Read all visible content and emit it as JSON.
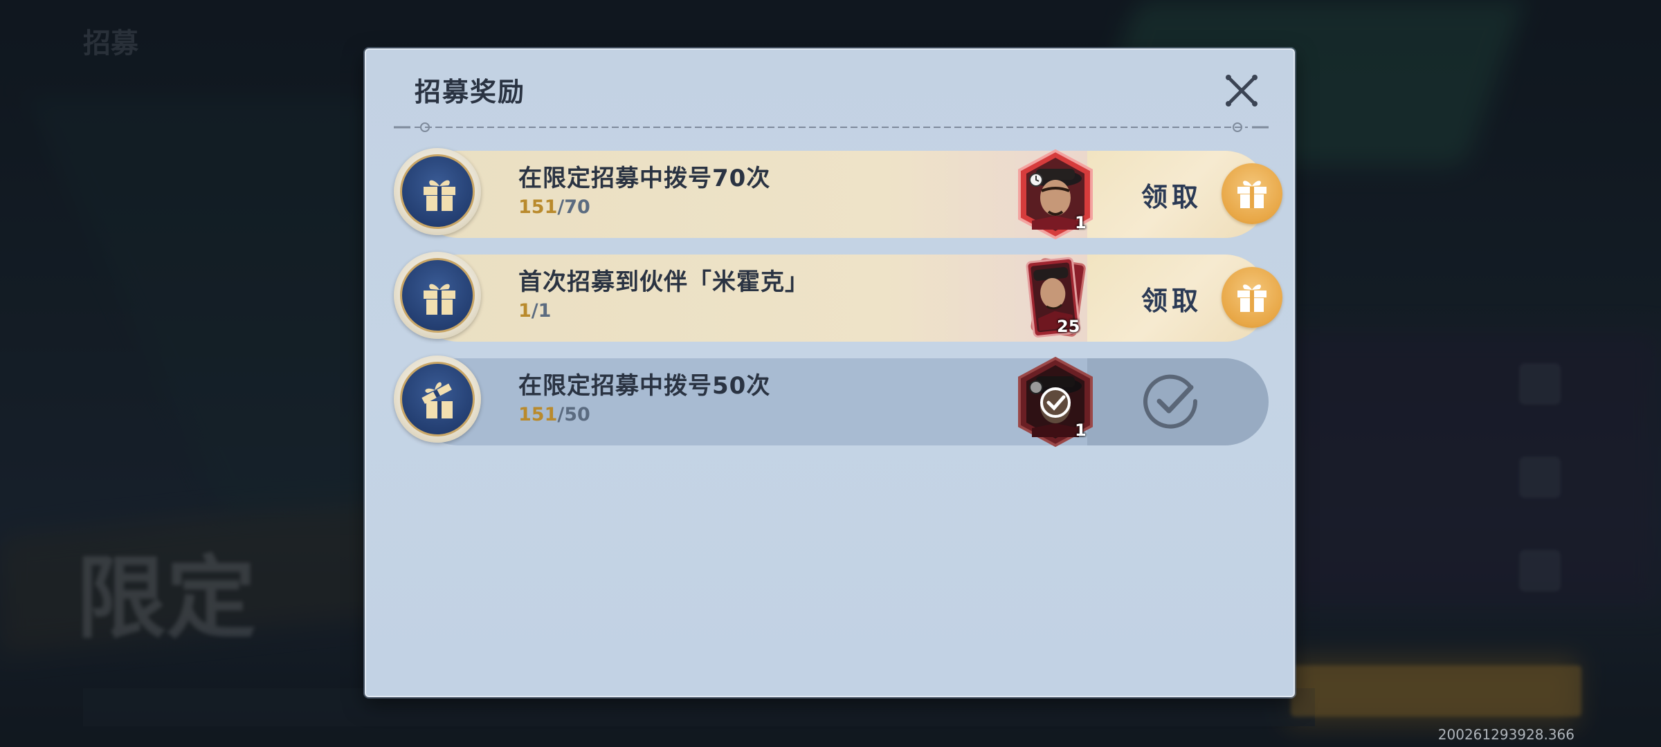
{
  "background": {
    "top_text": "招募",
    "title_text": "限定",
    "version": "200261293928.366"
  },
  "dialog": {
    "title": "招募奖励",
    "close_icon": "close-x-icon"
  },
  "tasks": [
    {
      "title": "在限定招募中拨号70次",
      "progress_current": "151",
      "progress_sep_total": "/70",
      "reward_count": "1",
      "reward_type": "hexagon-portrait",
      "status": "claimable",
      "claim_label": "领取"
    },
    {
      "title": "首次招募到伙伴「米霍克」",
      "progress_current": "1",
      "progress_sep_total": "/1",
      "reward_count": "25",
      "reward_type": "card-portrait",
      "status": "claimable",
      "claim_label": "领取"
    },
    {
      "title": "在限定招募中拨号50次",
      "progress_current": "151",
      "progress_sep_total": "/50",
      "reward_count": "1",
      "reward_type": "hexagon-portrait",
      "status": "claimed",
      "claim_label": ""
    }
  ],
  "colors": {
    "accent_gold": "#b98a2c",
    "claim_orange": "#e8a746",
    "panel_blue": "#c3d2e3",
    "icon_navy": "#243f72",
    "portrait_red": "#c9353a"
  }
}
